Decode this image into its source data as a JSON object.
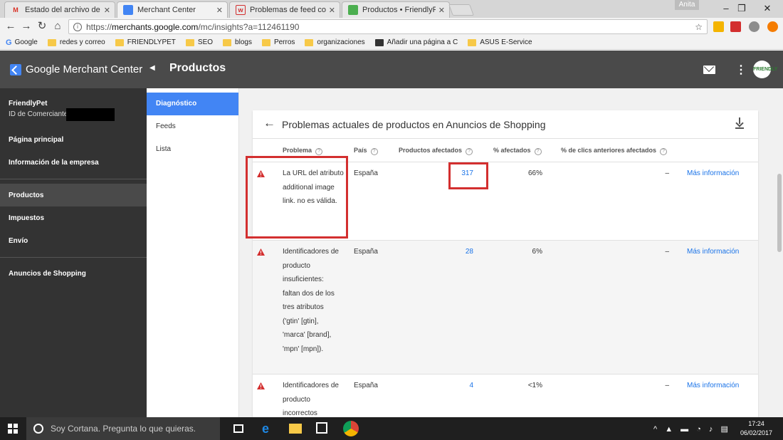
{
  "browser": {
    "tabs": [
      {
        "label": "Estado del archivo de fe",
        "favicon": "gmail-icon",
        "fav_text": "M",
        "fav_color": "#d93025"
      },
      {
        "label": "Merchant Center",
        "favicon": "merchant-center-icon",
        "fav_text": "",
        "fav_color": "#4285f4"
      },
      {
        "label": "Problemas de feed con e",
        "favicon": "store-icon",
        "fav_text": "w",
        "fav_color": "#d32f2f"
      },
      {
        "label": "Productos • FriendlyPet",
        "favicon": "sheets-icon",
        "fav_text": "",
        "fav_color": "#4caf50"
      }
    ],
    "user_chip": "Anita",
    "url_prefix": "https://",
    "url_host": "merchants.google.com",
    "url_path": "/mc/insights?a=112461190",
    "bookmarks": [
      {
        "label": "Google",
        "type": "google"
      },
      {
        "label": "redes y correo",
        "type": "folder"
      },
      {
        "label": "FRIENDLYPET",
        "type": "folder"
      },
      {
        "label": "SEO",
        "type": "folder"
      },
      {
        "label": "blogs",
        "type": "folder"
      },
      {
        "label": "Perros",
        "type": "folder"
      },
      {
        "label": "organizaciones",
        "type": "folder"
      },
      {
        "label": "Añadir una página a C",
        "type": "page"
      },
      {
        "label": "ASUS E-Service",
        "type": "folder"
      }
    ]
  },
  "app": {
    "brand": "Google Merchant Center",
    "page_title": "Productos",
    "avatar_text": "FRIENDLY"
  },
  "sidebar": {
    "account_name": "FriendlyPet",
    "account_id_label": "ID de Comerciante:",
    "items": [
      {
        "label": "Página principal"
      },
      {
        "label": "Información de la empresa"
      },
      {
        "label": "Productos"
      },
      {
        "label": "Impuestos"
      },
      {
        "label": "Envío"
      },
      {
        "label": "Anuncios de Shopping"
      }
    ]
  },
  "subnav": {
    "items": [
      {
        "label": "Diagnóstico",
        "active": true
      },
      {
        "label": "Feeds"
      },
      {
        "label": "Lista"
      }
    ]
  },
  "card": {
    "title": "Problemas actuales de productos en Anuncios de Shopping",
    "columns": [
      "Problema",
      "País",
      "Productos afectados",
      "% afectados",
      "% de clics anteriores afectados"
    ],
    "rows": [
      {
        "problem": "La URL del atributo additional image link. no es válida.",
        "country": "España",
        "affected": "317",
        "pct": "66%",
        "clicks": "–",
        "more": "Más información"
      },
      {
        "problem": "Identificadores de producto insuficientes: faltan dos de los tres atributos ('gtin' [gtin], 'marca' [brand], 'mpn' [mpn]).",
        "country": "España",
        "affected": "28",
        "pct": "6%",
        "clicks": "–",
        "more": "Más información"
      },
      {
        "problem": "Identificadores de producto incorrectos",
        "country": "España",
        "affected": "4",
        "pct": "<1%",
        "clicks": "–",
        "more": "Más información"
      }
    ]
  },
  "taskbar": {
    "search_placeholder": "Soy Cortana. Pregunta lo que quieras.",
    "time": "17:24",
    "date": "06/02/2017"
  },
  "colors": {
    "accent": "#4285f4",
    "header": "#4a4a4a",
    "sidebar": "#333333",
    "warning": "#d32f2f",
    "link": "#1a73e8"
  }
}
